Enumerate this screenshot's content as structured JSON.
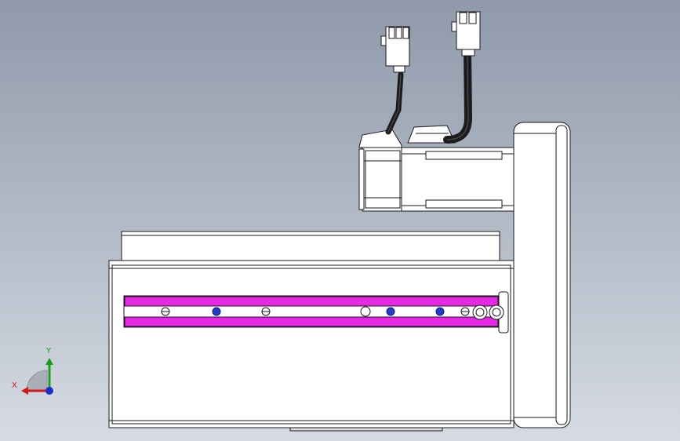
{
  "viewport": {
    "background_top": "#8f99aa",
    "background_bottom": "#d6dbe3"
  },
  "model": {
    "view": "front",
    "body_color": "#ffffff",
    "line_color": "#1a1a1a",
    "slot_color": "#e628e6",
    "dark_hole_color": "#1f3ccc",
    "cable_color": "#1c1c1c"
  },
  "triad": {
    "x_label": "X",
    "y_label": "Y",
    "x_color": "#d01818",
    "y_color": "#18a018",
    "z_color": "#1a2fd0"
  }
}
